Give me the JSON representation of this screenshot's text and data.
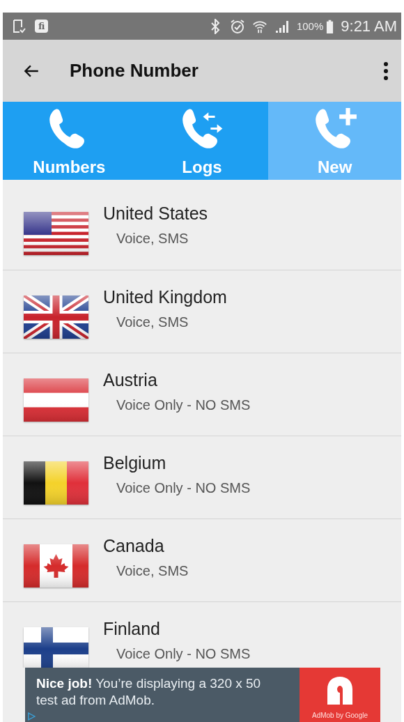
{
  "status_bar": {
    "badge": "fi",
    "battery": "100%",
    "time": "9:21 AM"
  },
  "toolbar": {
    "title": "Phone Number"
  },
  "tabs": [
    {
      "label": "Numbers",
      "kind": "phone",
      "selected": false
    },
    {
      "label": "Logs",
      "kind": "logs",
      "selected": false
    },
    {
      "label": "New",
      "kind": "new",
      "selected": true
    }
  ],
  "countries": [
    {
      "kind": "us",
      "name": "United States",
      "features": "Voice, SMS"
    },
    {
      "kind": "uk",
      "name": "United Kingdom",
      "features": "Voice, SMS"
    },
    {
      "kind": "at",
      "name": "Austria",
      "features": "Voice Only - NO SMS"
    },
    {
      "kind": "be",
      "name": "Belgium",
      "features": "Voice Only - NO SMS"
    },
    {
      "kind": "ca",
      "name": "Canada",
      "features": "Voice, SMS"
    },
    {
      "kind": "fi",
      "name": "Finland",
      "features": "Voice Only - NO SMS"
    }
  ],
  "ad": {
    "text": "**Nice job!** You’re displaying a 320 x 50 test ad from AdMob.",
    "brand": "AdMob by Google"
  }
}
